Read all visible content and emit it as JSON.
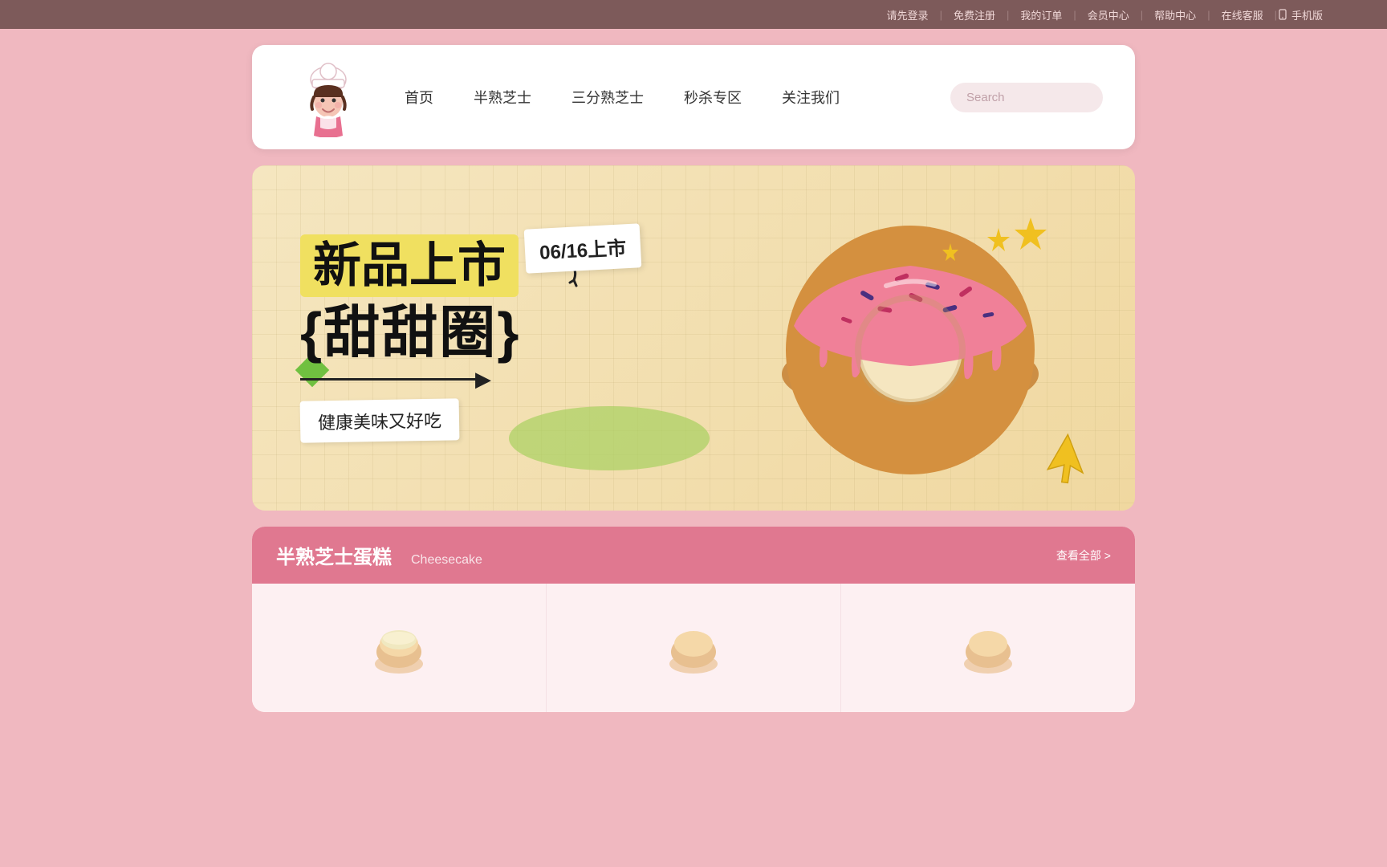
{
  "topbar": {
    "items": [
      {
        "label": "请先登录",
        "id": "login"
      },
      {
        "label": "免费注册",
        "id": "register"
      },
      {
        "label": "我的订单",
        "id": "orders"
      },
      {
        "label": "会员中心",
        "id": "membership"
      },
      {
        "label": "帮助中心",
        "id": "help"
      },
      {
        "label": "在线客服",
        "id": "service"
      },
      {
        "label": "手机版",
        "id": "mobile"
      }
    ]
  },
  "nav": {
    "links": [
      {
        "label": "首页",
        "id": "home"
      },
      {
        "label": "半熟芝士",
        "id": "half-cheese"
      },
      {
        "label": "三分熟芝士",
        "id": "three-cheese"
      },
      {
        "label": "秒杀专区",
        "id": "flash-sale"
      },
      {
        "label": "关注我们",
        "id": "follow"
      }
    ],
    "search_placeholder": "Search"
  },
  "banner": {
    "date": "06/16上市",
    "line1": "新品上市",
    "line2": "{甜甜圈}",
    "subtitle": "健康美味又好吃"
  },
  "section": {
    "title_cn": "半熟芝士蛋糕",
    "title_en": "Cheesecake",
    "view_all": "查看全部 >"
  },
  "colors": {
    "topbar_bg": "#7d5a5a",
    "pink_bg": "#f0b8c0",
    "header_bg": "#ffffff",
    "banner_bg": "#f5e6c0",
    "section_header": "#e07890",
    "search_bg": "#f5e8ea",
    "accent_yellow": "#f0e060",
    "accent_green": "#a8d060"
  }
}
